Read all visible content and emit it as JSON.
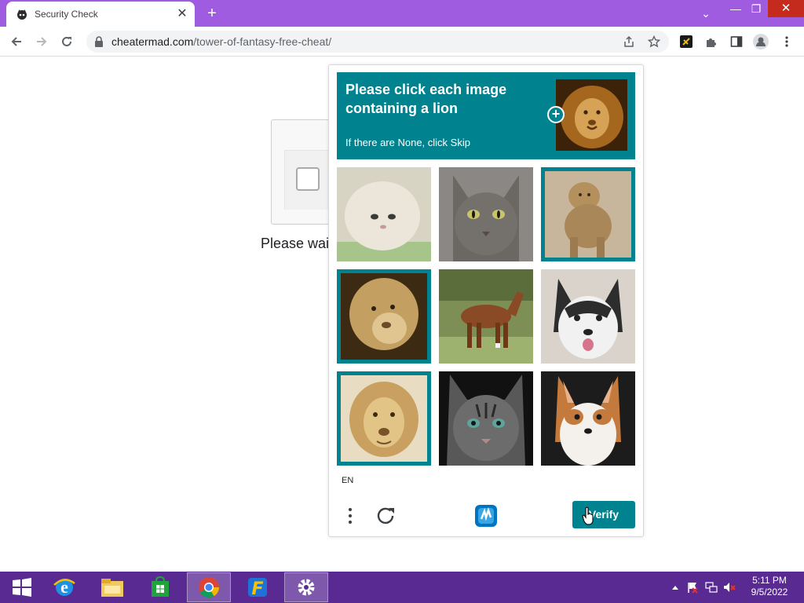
{
  "browser": {
    "tab_title": "Security Check",
    "tab_close_glyph": "✕",
    "new_tab_glyph": "+",
    "url_domain": "cheatermad.com",
    "url_path": "/tower-of-fantasy-free-cheat/",
    "window_controls": {
      "dropdown": "⌄",
      "minimize": "—",
      "maximize": "❐",
      "close": "✕"
    },
    "toolbar_icons": [
      "back-icon",
      "forward-icon",
      "reload-icon",
      "share-icon",
      "star-icon",
      "extension-app-icon",
      "puzzle-extensions-icon",
      "side-panel-icon",
      "profile-icon",
      "menu-icon"
    ]
  },
  "page": {
    "wait_text": "Please wai"
  },
  "captcha": {
    "prompt_line1": "Please click each image containing a lion",
    "prompt_sub": "If there are None, click Skip",
    "prompt_plus": "+",
    "accent_color": "#00838f",
    "images": [
      {
        "subject": "persian-cat",
        "selected": false
      },
      {
        "subject": "tabby-cat",
        "selected": false
      },
      {
        "subject": "lion",
        "selected": true
      },
      {
        "subject": "lioness",
        "selected": true
      },
      {
        "subject": "horse",
        "selected": false
      },
      {
        "subject": "husky",
        "selected": false
      },
      {
        "subject": "lion",
        "selected": true
      },
      {
        "subject": "tabby-cat",
        "selected": false
      },
      {
        "subject": "corgi",
        "selected": false
      }
    ],
    "language": "EN",
    "verify_label": "Verify"
  },
  "taskbar": {
    "apps": [
      "windows-start-icon",
      "internet-explorer-icon",
      "file-explorer-icon",
      "store-icon",
      "chrome-icon",
      "flashget-icon",
      "settings-icon"
    ],
    "active_app": "chrome-icon",
    "tray_icons": [
      "show-hidden-icon",
      "flag-icon",
      "network-icon",
      "volume-muted-icon"
    ],
    "time": "5:11 PM",
    "date": "9/5/2022"
  }
}
